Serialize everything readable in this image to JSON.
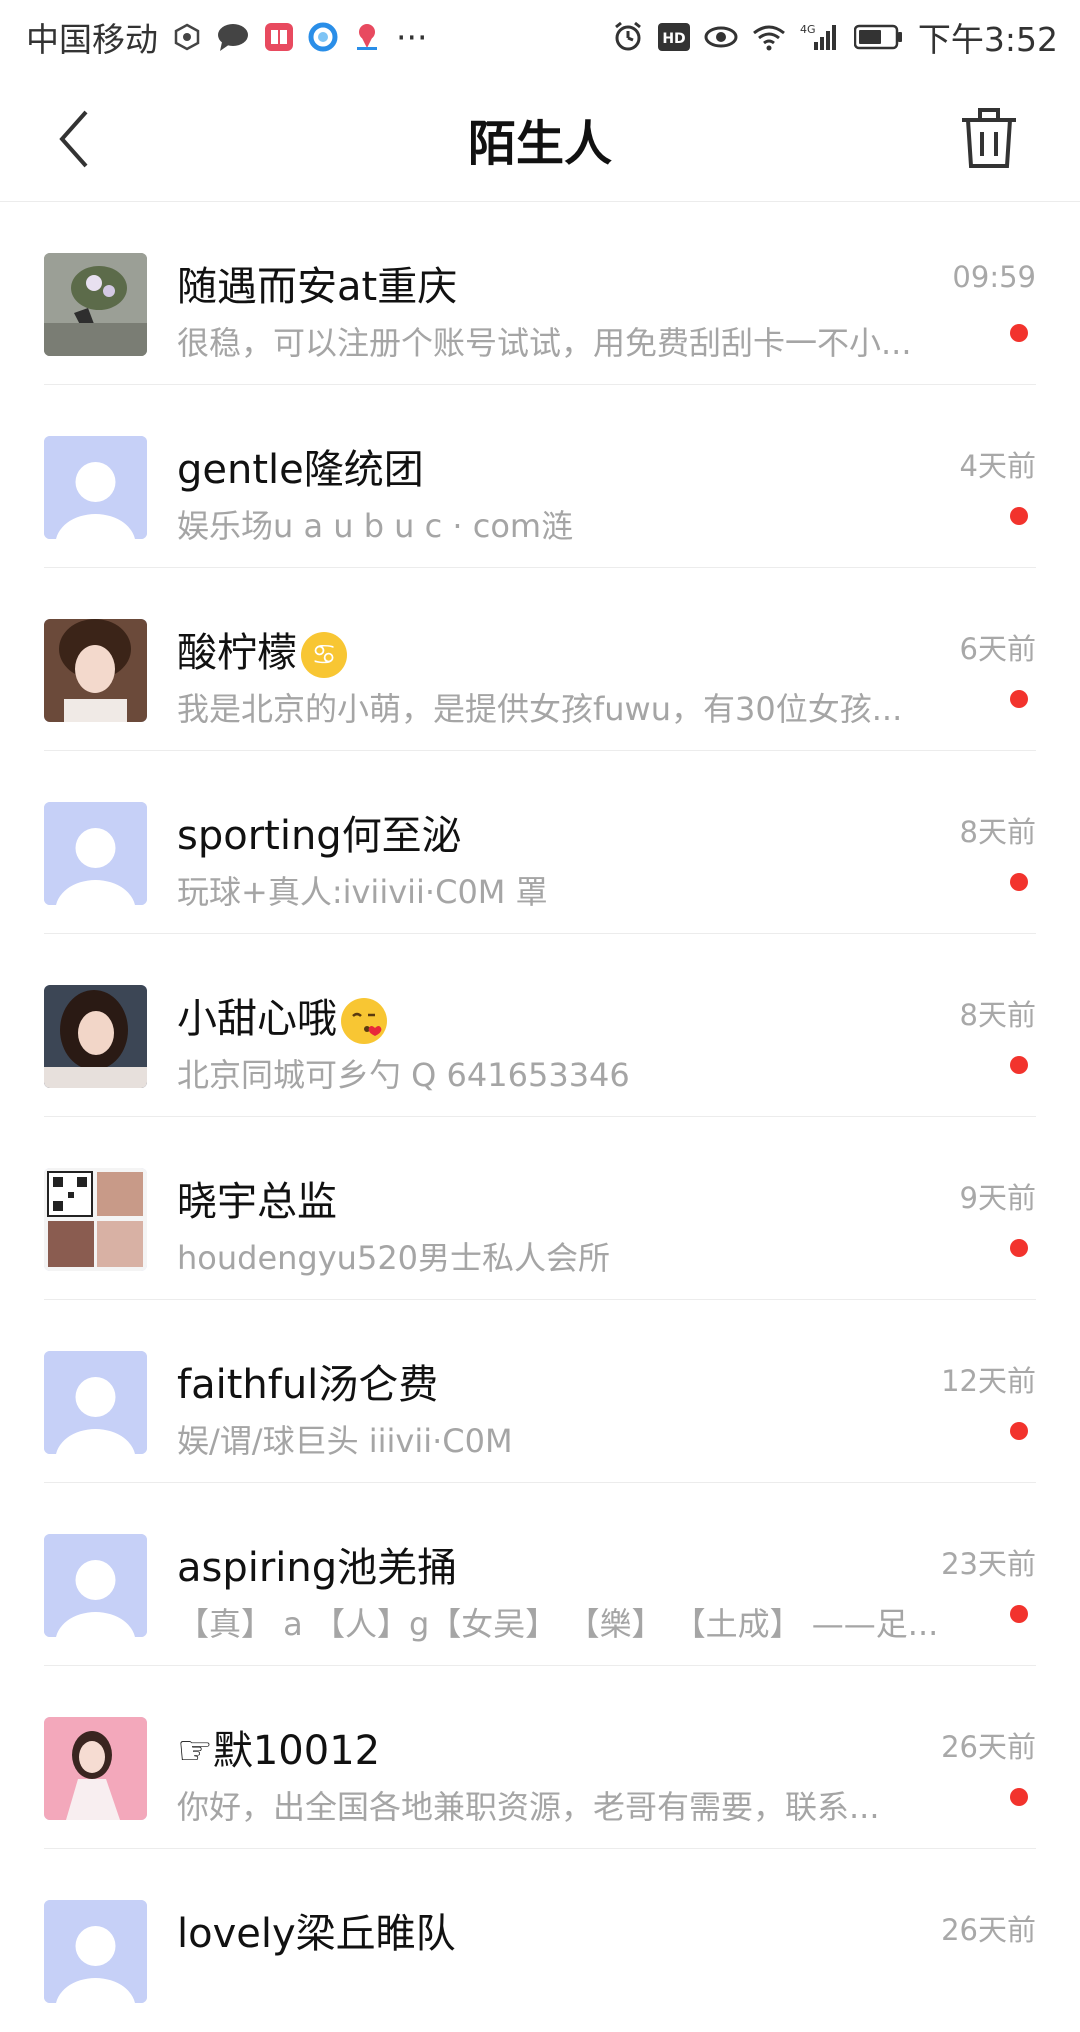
{
  "status_bar": {
    "carrier": "中国移动",
    "more": "···",
    "network": "4G",
    "time": "下午3:52"
  },
  "header": {
    "title": "陌生人"
  },
  "conversations": [
    {
      "name": "随遇而安at重庆",
      "preview": "很稳，可以注册个账号试试，用免费刮刮卡一不小...",
      "time": "09:59",
      "avatar": "photo-plants"
    },
    {
      "name": "gentle隆统团",
      "preview": "娱乐场u a u b u c · com涟",
      "time": "4天前",
      "avatar": "default"
    },
    {
      "name": "酸柠檬",
      "preview": "我是北京的小萌，是提供女孩fuwu，有30位女孩...",
      "time": "6天前",
      "avatar": "photo-girl",
      "emoji": "♋"
    },
    {
      "name": "sporting何至泌",
      "preview": "玩球+真人:iviivii·C0M 罩",
      "time": "8天前",
      "avatar": "default"
    },
    {
      "name": "小甜心哦",
      "preview": "北京同城可乡勺  Q  641653346",
      "time": "8天前",
      "avatar": "photo-girl2",
      "emoji": "kiss-face"
    },
    {
      "name": "晓宇总监",
      "preview": "houdengyu520男士私人会所",
      "time": "9天前",
      "avatar": "photo-collage"
    },
    {
      "name": "faithful汤仑费",
      "preview": "娱/谓/球巨头 iiivii·C0M",
      "time": "12天前",
      "avatar": "default"
    },
    {
      "name": "aspiring池羌捅",
      "preview": "【真】 a 【人】g【女吴】 【樂】 【土成】 ——足...",
      "time": "23天前",
      "avatar": "default"
    },
    {
      "name": "☞默10012",
      "preview": "  你好，出全国各地兼职资源，老哥有需要，联系...",
      "time": "26天前",
      "avatar": "photo-pink"
    },
    {
      "name": "lovely梁丘睢队",
      "preview": "",
      "time": "26天前",
      "avatar": "default"
    }
  ],
  "colors": {
    "unread_dot": "#f2332d",
    "default_avatar_bg": "#c6d0f7",
    "secondary_text": "#a5a5a5"
  }
}
